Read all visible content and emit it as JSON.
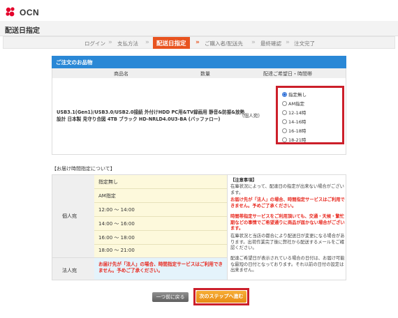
{
  "header": {
    "brand": "OCN"
  },
  "page": {
    "title": "配送日指定"
  },
  "steps": {
    "items": [
      "ログイン",
      "支払方法",
      "配送日指定",
      "ご購入者/配送先",
      "最終確認",
      "注文完了"
    ],
    "active": "配送日指定"
  },
  "order": {
    "heading": "ご注文のお品物",
    "columns": {
      "product": "商品名",
      "quantity": "数量",
      "delivery": "配達ご希望日・時間帯"
    },
    "product_name": "USB3.1(Gen1)/USB3.0/USB2.0接続 外付けHDD PC用&TV録画用 静音&防振&放熱設計 日本製 見守り合図 4TB ブラック HD-NRLD4.0U3-BA (バッファロー)",
    "unit_label": "(個人宛)",
    "options": [
      "指定無し",
      "AM指定",
      "12-14時",
      "14-16時",
      "16-18時",
      "18-21時"
    ],
    "selected": "指定無し"
  },
  "timeinfo": {
    "title": "【お届け時間指定について】",
    "personal_label": "個人宛",
    "corporate_label": "法人宛",
    "slots": [
      "指定無し",
      "AM指定",
      "12:00 ～ 14:00",
      "14:00 ～ 16:00",
      "16:00 ～ 18:00",
      "18:00 ～ 21:00"
    ],
    "corporate_note": "お届け先が「法人」の場合、時間指定サービスはご利用できません。予めご了承ください。",
    "notes": {
      "heading": "【注意事項】",
      "p1": "在庫状況によって、配達日の指定が出来ない場合がございます。",
      "p2": "お届け先が「法人」の場合、時間指定サービスはご利用できません。予めご了承ください。",
      "p3": "時間帯指定サービスをご利用頂いても、交通・天候・繁忙期などの事情でご希望通りに商品が届かない場合がございます。",
      "p4": "在庫状況と当店の都合により配送日が変更になる場合があります。出荷作業完了後に弊社から配送するメールをご確認ください。",
      "p5": "配達ご希望日が表示されている場合の日付は、お届け可能な最短の日付となっております。それ以前の日付の設定は出来ません。"
    }
  },
  "buttons": {
    "back": "一つ前に戻る",
    "next": "次のステップへ進む"
  },
  "colors": {
    "accent": "#e8531f",
    "panel_blue": "#2a88d6",
    "highlight_red": "#cc1f2a",
    "warning_red": "#e8261c"
  }
}
